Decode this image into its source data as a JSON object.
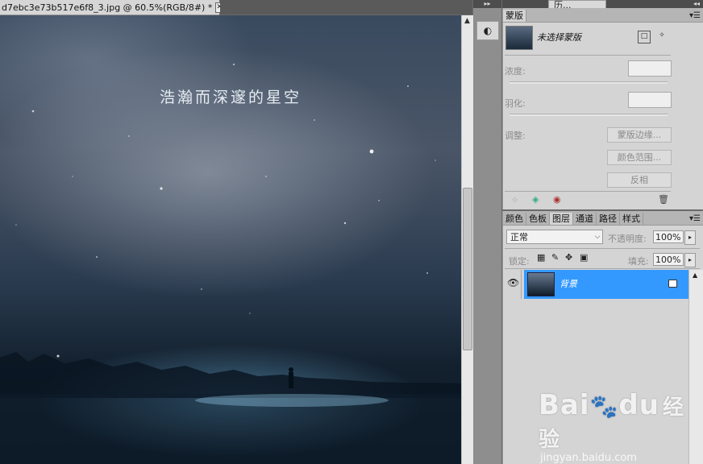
{
  "document": {
    "tab_title": "d7ebc3e73b517e6f8_3.jpg @ 60.5%(RGB/8#) *",
    "close_glyph": "✕",
    "canvas_caption": "浩瀚而深邃的星空"
  },
  "dock": {
    "history_tab": "历...",
    "collapse_glyph": "◂◂",
    "expand_glyph": "▸▸"
  },
  "masks_panel": {
    "tab": "蒙版",
    "menu_glyph": "▾☰",
    "selection_label": "未选择蒙版",
    "density_label": "浓度:",
    "feather_label": "羽化:",
    "adjust_label": "调整:",
    "mask_edge_button": "蒙版边缘...",
    "color_range_button": "颜色范围...",
    "invert_button": "反相"
  },
  "layers_panel": {
    "tabs": [
      "颜色",
      "色板",
      "图层",
      "通道",
      "路径",
      "样式"
    ],
    "active_tab_index": 2,
    "menu_glyph": "▾☰",
    "blend_mode": "正常",
    "opacity_label": "不透明度:",
    "opacity_value": "100%",
    "lock_label": "锁定:",
    "fill_label": "填充:",
    "fill_value": "100%",
    "layers": [
      {
        "name": "背景",
        "selected": true,
        "visible": true,
        "locked": true
      }
    ]
  },
  "watermark": {
    "logo_text": "Bai",
    "logo_text2": "du",
    "logo_suffix": "经验",
    "url": "jingyan.baidu.com"
  }
}
